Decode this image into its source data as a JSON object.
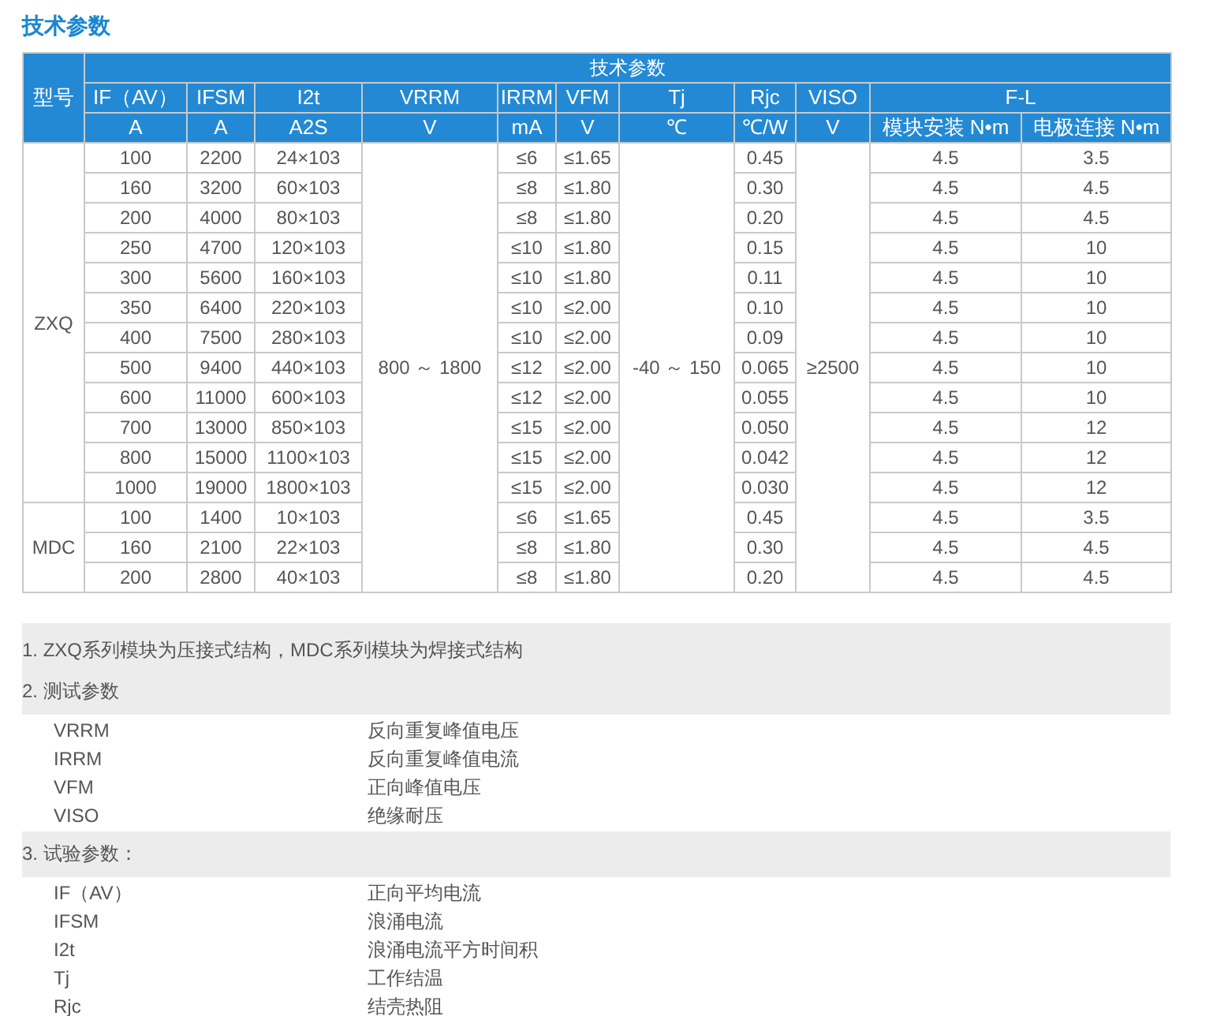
{
  "title": "技术参数",
  "table": {
    "model_header": "型号",
    "group_header": "技术参数",
    "columns": [
      {
        "name": "IF（AV）",
        "unit": "A"
      },
      {
        "name": "IFSM",
        "unit": "A"
      },
      {
        "name": "I2t",
        "unit": "A2S"
      },
      {
        "name": "VRRM",
        "unit": "V"
      },
      {
        "name": "IRRM",
        "unit": "mA"
      },
      {
        "name": "VFM",
        "unit": "V"
      },
      {
        "name": "Tj",
        "unit": "℃"
      },
      {
        "name": "Rjc",
        "unit": "℃/W"
      },
      {
        "name": "VISO",
        "unit": "V"
      }
    ],
    "fl": {
      "name": "F-L",
      "units": [
        "模块安装 N•m",
        "电极连接 N•m"
      ]
    },
    "shared": {
      "vrrm": "800 ～ 1800",
      "tj": "-40 ～ 150",
      "viso": "≥2500"
    },
    "groups": [
      {
        "model": "ZXQ",
        "rows": [
          [
            "100",
            "2200",
            "24×103",
            "≤6",
            "≤1.65",
            "0.45",
            "4.5",
            "3.5"
          ],
          [
            "160",
            "3200",
            "60×103",
            "≤8",
            "≤1.80",
            "0.30",
            "4.5",
            "4.5"
          ],
          [
            "200",
            "4000",
            "80×103",
            "≤8",
            "≤1.80",
            "0.20",
            "4.5",
            "4.5"
          ],
          [
            "250",
            "4700",
            "120×103",
            "≤10",
            "≤1.80",
            "0.15",
            "4.5",
            "10"
          ],
          [
            "300",
            "5600",
            "160×103",
            "≤10",
            "≤1.80",
            "0.11",
            "4.5",
            "10"
          ],
          [
            "350",
            "6400",
            "220×103",
            "≤10",
            "≤2.00",
            "0.10",
            "4.5",
            "10"
          ],
          [
            "400",
            "7500",
            "280×103",
            "≤10",
            "≤2.00",
            "0.09",
            "4.5",
            "10"
          ],
          [
            "500",
            "9400",
            "440×103",
            "≤12",
            "≤2.00",
            "0.065",
            "4.5",
            "10"
          ],
          [
            "600",
            "11000",
            "600×103",
            "≤12",
            "≤2.00",
            "0.055",
            "4.5",
            "10"
          ],
          [
            "700",
            "13000",
            "850×103",
            "≤15",
            "≤2.00",
            "0.050",
            "4.5",
            "12"
          ],
          [
            "800",
            "15000",
            "1100×103",
            "≤15",
            "≤2.00",
            "0.042",
            "4.5",
            "12"
          ],
          [
            "1000",
            "19000",
            "1800×103",
            "≤15",
            "≤2.00",
            "0.030",
            "4.5",
            "12"
          ]
        ]
      },
      {
        "model": "MDC",
        "rows": [
          [
            "100",
            "1400",
            "10×103",
            "≤6",
            "≤1.65",
            "0.45",
            "4.5",
            "3.5"
          ],
          [
            "160",
            "2100",
            "22×103",
            "≤8",
            "≤1.80",
            "0.30",
            "4.5",
            "4.5"
          ],
          [
            "200",
            "2800",
            "40×103",
            "≤8",
            "≤1.80",
            "0.20",
            "4.5",
            "4.5"
          ]
        ]
      }
    ]
  },
  "notes": [
    {
      "heading": "1. ZXQ系列模块为压接式结构，MDC系列模块为焊接式结构"
    },
    {
      "heading": "2. 测试参数",
      "items": [
        {
          "term": "VRRM",
          "meaning": "反向重复峰值电压"
        },
        {
          "term": "IRRM",
          "meaning": "反向重复峰值电流"
        },
        {
          "term": "VFM",
          "meaning": "正向峰值电压"
        },
        {
          "term": "VISO",
          "meaning": "绝缘耐压"
        }
      ]
    },
    {
      "heading": "3. 试验参数：",
      "items": [
        {
          "term": "IF（AV）",
          "meaning": "正向平均电流"
        },
        {
          "term": "IFSM",
          "meaning": "浪涌电流"
        },
        {
          "term": "I2t",
          "meaning": "浪涌电流平方时间积"
        },
        {
          "term": "Tj",
          "meaning": "工作结温"
        },
        {
          "term": "Rjc",
          "meaning": "结壳热阻"
        }
      ]
    }
  ]
}
